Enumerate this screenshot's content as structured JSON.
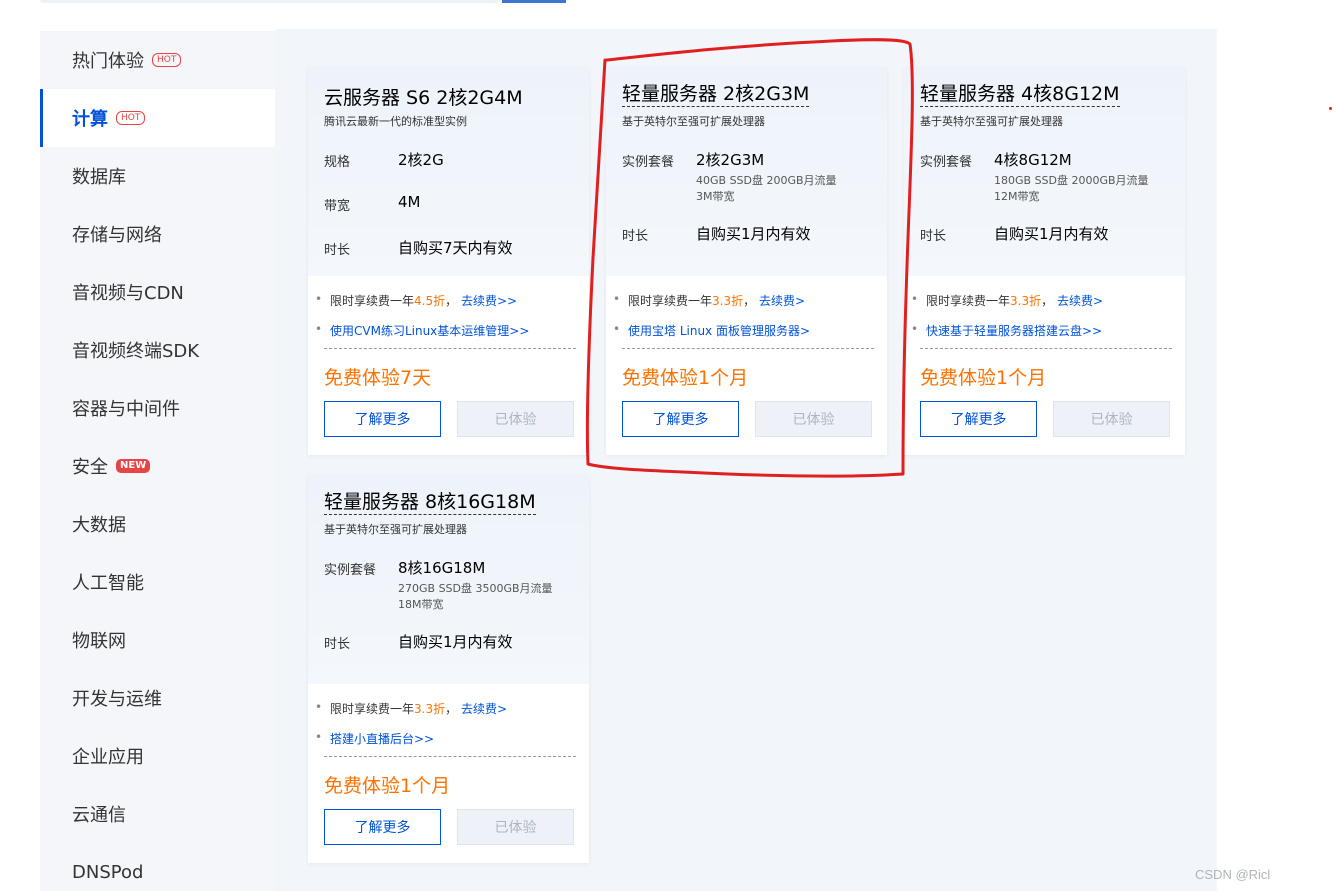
{
  "sidebar": {
    "items": [
      {
        "label": "热门体验",
        "tag": "HOT"
      },
      {
        "label": "计算",
        "tag": "HOT"
      },
      {
        "label": "数据库"
      },
      {
        "label": "存储与网络"
      },
      {
        "label": "音视频与CDN"
      },
      {
        "label": "音视频终端SDK"
      },
      {
        "label": "容器与中间件"
      },
      {
        "label": "安全",
        "tag": "NEW"
      },
      {
        "label": "大数据"
      },
      {
        "label": "人工智能"
      },
      {
        "label": "物联网"
      },
      {
        "label": "开发与运维"
      },
      {
        "label": "企业应用"
      },
      {
        "label": "云通信"
      },
      {
        "label": "DNSPod"
      }
    ],
    "active_index": 1
  },
  "cards": [
    {
      "title": "云服务器 S6 2核2G4M",
      "subtitle": "腾讯云最新一代的标准型实例",
      "specs": [
        {
          "label": "规格",
          "value": "2核2G"
        },
        {
          "label": "带宽",
          "value": "4M"
        },
        {
          "label": "时长",
          "value": "自购买7天内有效"
        }
      ],
      "promo1": {
        "text": "限时享续费一年",
        "discount": "4.5折",
        "sep": "，",
        "link": "去续费>>"
      },
      "promo2": {
        "link": "使用CVM练习Linux基本运维管理>>"
      },
      "free_label": "免费体验7天",
      "btn_more": "了解更多",
      "btn_done": "已体验"
    },
    {
      "title": "轻量服务器 2核2G3M",
      "subtitle": "基于英特尔至强可扩展处理器",
      "specs": [
        {
          "label": "实例套餐",
          "value": "2核2G3M",
          "note1": "40GB SSD盘 200GB月流量",
          "note2": "3M带宽"
        },
        {
          "label": "时长",
          "value": "自购买1月内有效"
        }
      ],
      "promo1": {
        "text": "限时享续费一年",
        "discount": "3.3折",
        "sep": "，",
        "link": "去续费>"
      },
      "promo2": {
        "link": "使用宝塔 Linux 面板管理服务器>"
      },
      "free_label": "免费体验1个月",
      "btn_more": "了解更多",
      "btn_done": "已体验"
    },
    {
      "title": "轻量服务器 4核8G12M",
      "subtitle": "基于英特尔至强可扩展处理器",
      "specs": [
        {
          "label": "实例套餐",
          "value": "4核8G12M",
          "note1": "180GB SSD盘 2000GB月流量",
          "note2": "12M带宽"
        },
        {
          "label": "时长",
          "value": "自购买1月内有效"
        }
      ],
      "promo1": {
        "text": "限时享续费一年",
        "discount": "3.3折",
        "sep": "，",
        "link": "去续费>"
      },
      "promo2": {
        "link": "快速基于轻量服务器搭建云盘>>"
      },
      "free_label": "免费体验1个月",
      "btn_more": "了解更多",
      "btn_done": "已体验"
    },
    {
      "title": "轻量服务器 8核16G18M",
      "subtitle": "基于英特尔至强可扩展处理器",
      "specs": [
        {
          "label": "实例套餐",
          "value": "8核16G18M",
          "note1": "270GB SSD盘 3500GB月流量",
          "note2": "18M带宽"
        },
        {
          "label": "时长",
          "value": "自购买1月内有效"
        }
      ],
      "promo1": {
        "text": "限时享续费一年",
        "discount": "3.3折",
        "sep": "，",
        "link": "去续费>"
      },
      "promo2": {
        "link": "搭建小直播后台>>"
      },
      "free_label": "免费体验1个月",
      "btn_more": "了解更多",
      "btn_done": "已体验"
    }
  ],
  "watermark": "CSDN @Ricl",
  "colors": {
    "accent": "#0052d9",
    "orange": "#ff7200",
    "tag_red": "#e54545",
    "annotation": "#e02020"
  }
}
